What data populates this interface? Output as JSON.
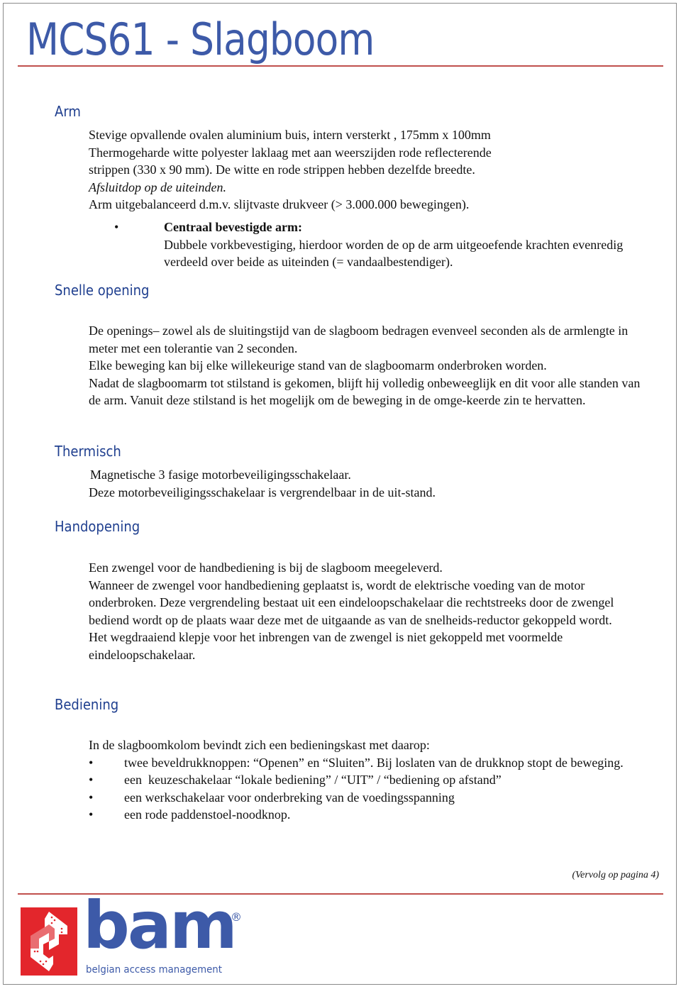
{
  "document": {
    "title": "MCS61 - Slagboom",
    "sections": {
      "arm": {
        "heading": "Arm",
        "lines": [
          "Stevige opvallende ovalen aluminium buis, intern versterkt , 175mm x 100mm",
          "Thermogeharde witte polyester laklaag met aan weerszijden rode reflecterende",
          "strippen (330 x 90 mm). De witte en rode strippen hebben dezelfde breedte.",
          "Afsluitdop op de uiteinden.",
          "Arm uitgebalanceerd d.m.v. slijtvaste drukveer (> 3.000.000 bewegingen)."
        ],
        "bullet": {
          "symbol": "•",
          "title": "Centraal bevestigde arm:",
          "text": "Dubbele vorkbevestiging, hierdoor worden de op de arm uitgeoefende krachten evenredig verdeeld over beide as uiteinden (= vandaalbestendiger)."
        }
      },
      "snelle_opening": {
        "heading": "Snelle opening",
        "paragraphs": [
          "De openings– zowel als de sluitingstijd van de slagboom bedragen evenveel seconden als de armlengte in meter met een tolerantie van 2 seconden.",
          "Elke beweging kan bij elke willekeurige stand van de slagboomarm onderbroken worden.",
          "Nadat de slagboomarm tot stilstand is gekomen, blijft hij volledig onbeweeglijk en dit voor alle standen van de arm. Vanuit deze stilstand is het mogelijk om de beweging in de omge-keerde zin te hervatten."
        ]
      },
      "thermisch": {
        "heading": "Thermisch",
        "lines": [
          "Magnetische 3 fasige motorbeveiligingsschakelaar.",
          "Deze motorbeveiligingsschakelaar is vergrendelbaar in de uit-stand."
        ]
      },
      "handopening": {
        "heading": "Handopening",
        "paragraphs": [
          "Een zwengel voor de handbediening is bij de slagboom meegeleverd.",
          "Wanneer de zwengel voor handbediening geplaatst is, wordt de elektrische voeding van de motor onderbroken. Deze vergrendeling bestaat uit een eindeloopschakelaar die rechtstreeks door de zwengel bediend wordt op de plaats waar deze met de uitgaande as van de snelheids-reductor gekoppeld wordt.",
          "Het wegdraaiend klepje voor het inbrengen van de zwengel is niet gekoppeld met voormelde eindeloopschakelaar."
        ]
      },
      "bediening": {
        "heading": "Bediening",
        "intro": "In de slagboomkolom bevindt zich een bedieningskast met daarop:",
        "bullet_symbol": "•",
        "items": [
          "twee beveldrukknoppen: “Openen” en “Sluiten”. Bij loslaten van de drukknop stopt de beweging.",
          "een  keuzeschakelaar “lokale bediening” / “UIT” / “bediening op afstand”",
          "een werkschakelaar voor onderbreking van de voedingsspanning",
          "een rode paddenstoel-noodknop."
        ]
      }
    },
    "continuation": "(Vervolg op pagina 4)"
  },
  "footer": {
    "logo": {
      "icon": "bam-braille-arrows-icon",
      "wordmark": "bam",
      "registered": "®",
      "tagline": "belgian access management"
    }
  },
  "colors": {
    "title_blue": "#3d5aa8",
    "heading_blue": "#1f3f8f",
    "rule_red": "#c0504d",
    "logo_red": "#e3262c"
  }
}
